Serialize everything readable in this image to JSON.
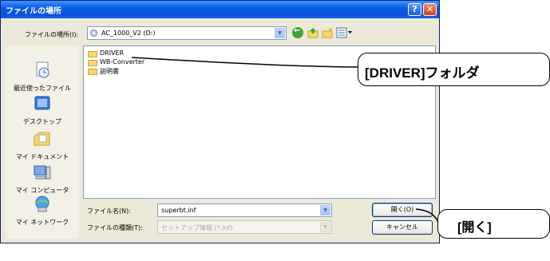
{
  "dialog": {
    "title": "ファイルの場所",
    "help_label": "?",
    "close_label": "✕"
  },
  "lookin": {
    "label": "ファイルの場所(I):",
    "value": "AC_1000_V2 (D:)"
  },
  "places": [
    {
      "label": "最近使ったファイル",
      "icon": "recent-documents-icon"
    },
    {
      "label": "デスクトップ",
      "icon": "desktop-icon"
    },
    {
      "label": "マイ ドキュメント",
      "icon": "my-documents-icon"
    },
    {
      "label": "マイ コンピュータ",
      "icon": "my-computer-icon"
    },
    {
      "label": "マイ ネットワーク",
      "icon": "my-network-icon"
    }
  ],
  "files": [
    {
      "name": "DRIVER",
      "icon": "folder-icon"
    },
    {
      "name": "WB-Converter",
      "icon": "folder-icon"
    },
    {
      "name": "説明書",
      "icon": "folder-icon"
    }
  ],
  "filename": {
    "label": "ファイル名(N):",
    "value": "superbt.inf"
  },
  "filetype": {
    "label": "ファイルの種類(T):",
    "value": "セットアップ情報 (*.inf)"
  },
  "buttons": {
    "open": "開く(O)",
    "cancel": "キャンセル"
  },
  "callouts": {
    "driver": "[DRIVER]フォルダ",
    "open": "[開く]"
  },
  "colors": {
    "titlebar": "#0b5ae6",
    "dialog_bg": "#ece9d8",
    "folder": "#f6d86b"
  }
}
